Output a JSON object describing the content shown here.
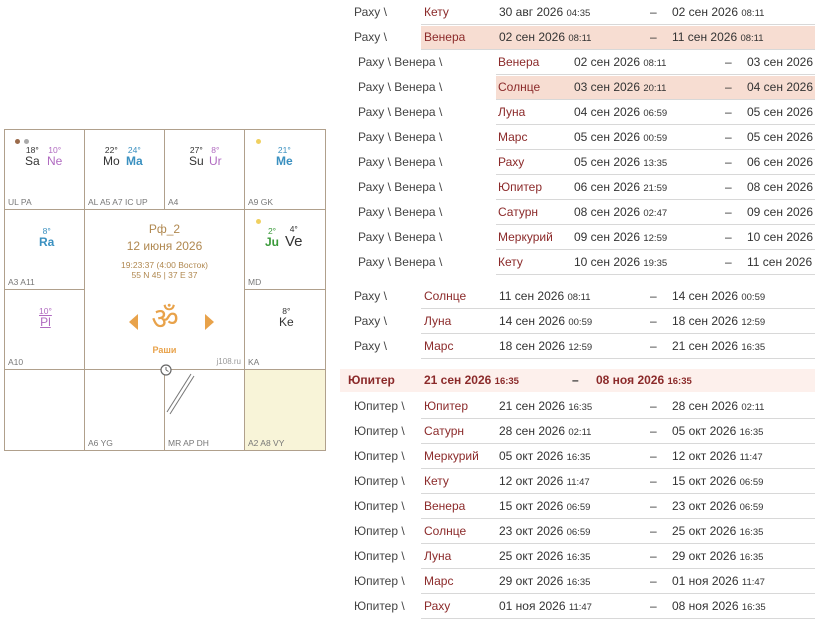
{
  "chart": {
    "name": "Рф_2",
    "date": "12 июня 2026",
    "time": "19:23:37 (4:00 Восток)",
    "coords": "55 N 45 | 37 E 37",
    "varga": "Раши",
    "site": "j108.ru",
    "om": "ॐ",
    "houses": [
      {
        "label": "UL PA"
      },
      {
        "label": "AL A5 A7 IC UP"
      },
      {
        "label": "A4"
      },
      {
        "label": "A9 GK"
      },
      {
        "label": "A3 A11"
      },
      {
        "label": "MD"
      },
      {
        "label": "A10"
      },
      {
        "label": "KA"
      },
      {
        "label": ""
      },
      {
        "label": "A6 YG"
      },
      {
        "label": "MR AP DH"
      },
      {
        "label": "A2 A8 VY"
      }
    ],
    "planets": {
      "sa": {
        "deg": "18°",
        "name": "Sa"
      },
      "ne": {
        "deg": "10°",
        "name": "Ne"
      },
      "mo": {
        "deg": "22°",
        "name": "Mo"
      },
      "ma": {
        "deg": "24°",
        "name": "Ma"
      },
      "su": {
        "deg": "27°",
        "name": "Su"
      },
      "ur": {
        "deg": "8°",
        "name": "Ur"
      },
      "me": {
        "deg": "21°",
        "name": "Me"
      },
      "ra": {
        "deg": "8°",
        "name": "Ra"
      },
      "ju": {
        "deg": "2°",
        "name": "Ju"
      },
      "ve": {
        "deg": "4°",
        "name": "Ve"
      },
      "pl": {
        "deg": "10°",
        "name": "Pl"
      },
      "ke": {
        "deg": "8°",
        "name": "Ke"
      }
    },
    "colors": {
      "border": "#b0a08c",
      "accent": "#e8a24a",
      "highlight_house": "#f8f4d8"
    }
  },
  "rows": [
    {
      "l1": "Раху \\",
      "l2": "Кету",
      "d1": "30 авг 2026",
      "t1": "04:35",
      "d2": "02 сен 2026",
      "t2": "08:11",
      "lvl": 1
    },
    {
      "l1": "Раху \\",
      "l2": "Венера",
      "d1": "02 сен 2026",
      "t1": "08:11",
      "d2": "11 сен 2026",
      "t2": "08:11",
      "lvl": 1,
      "hl": true
    },
    {
      "l1": "Раху \\ Венера \\",
      "l2": "Венера",
      "d1": "02 сен 2026",
      "t1": "08:11",
      "d2": "03 сен 2026",
      "t2": "",
      "lvl": 2
    },
    {
      "l1": "Раху \\ Венера \\",
      "l2": "Солнце",
      "d1": "03 сен 2026",
      "t1": "20:11",
      "d2": "04 сен 2026",
      "t2": "",
      "lvl": 2,
      "hl": true
    },
    {
      "l1": "Раху \\ Венера \\",
      "l2": "Луна",
      "d1": "04 сен 2026",
      "t1": "06:59",
      "d2": "05 сен 2026",
      "t2": "",
      "lvl": 2
    },
    {
      "l1": "Раху \\ Венера \\",
      "l2": "Марс",
      "d1": "05 сен 2026",
      "t1": "00:59",
      "d2": "05 сен 2026",
      "t2": "",
      "lvl": 2
    },
    {
      "l1": "Раху \\ Венера \\",
      "l2": "Раху",
      "d1": "05 сен 2026",
      "t1": "13:35",
      "d2": "06 сен 2026",
      "t2": "",
      "lvl": 2
    },
    {
      "l1": "Раху \\ Венера \\",
      "l2": "Юпитер",
      "d1": "06 сен 2026",
      "t1": "21:59",
      "d2": "08 сен 2026",
      "t2": "",
      "lvl": 2
    },
    {
      "l1": "Раху \\ Венера \\",
      "l2": "Сатурн",
      "d1": "08 сен 2026",
      "t1": "02:47",
      "d2": "09 сен 2026",
      "t2": "",
      "lvl": 2
    },
    {
      "l1": "Раху \\ Венера \\",
      "l2": "Меркурий",
      "d1": "09 сен 2026",
      "t1": "12:59",
      "d2": "10 сен 2026",
      "t2": "",
      "lvl": 2
    },
    {
      "l1": "Раху \\ Венера \\",
      "l2": "Кету",
      "d1": "10 сен 2026",
      "t1": "19:35",
      "d2": "11 сен 2026",
      "t2": "",
      "lvl": 2
    },
    {
      "l1": "Раху \\",
      "l2": "Солнце",
      "d1": "11 сен 2026",
      "t1": "08:11",
      "d2": "14 сен 2026",
      "t2": "00:59",
      "lvl": 1
    },
    {
      "l1": "Раху \\",
      "l2": "Луна",
      "d1": "14 сен 2026",
      "t1": "00:59",
      "d2": "18 сен 2026",
      "t2": "12:59",
      "lvl": 1
    },
    {
      "l1": "Раху \\",
      "l2": "Марс",
      "d1": "18 сен 2026",
      "t1": "12:59",
      "d2": "21 сен 2026",
      "t2": "16:35",
      "lvl": 1
    },
    {
      "l1": "Юпитер",
      "l2": "",
      "d1": "21 сен 2026",
      "t1": "16:35",
      "d2": "08 ноя 2026",
      "t2": "16:35",
      "lvl": 0
    },
    {
      "l1": "Юпитер \\",
      "l2": "Юпитер",
      "d1": "21 сен 2026",
      "t1": "16:35",
      "d2": "28 сен 2026",
      "t2": "02:11",
      "lvl": 1
    },
    {
      "l1": "Юпитер \\",
      "l2": "Сатурн",
      "d1": "28 сен 2026",
      "t1": "02:11",
      "d2": "05 окт 2026",
      "t2": "16:35",
      "lvl": 1
    },
    {
      "l1": "Юпитер \\",
      "l2": "Меркурий",
      "d1": "05 окт 2026",
      "t1": "16:35",
      "d2": "12 окт 2026",
      "t2": "11:47",
      "lvl": 1
    },
    {
      "l1": "Юпитер \\",
      "l2": "Кету",
      "d1": "12 окт 2026",
      "t1": "11:47",
      "d2": "15 окт 2026",
      "t2": "06:59",
      "lvl": 1
    },
    {
      "l1": "Юпитер \\",
      "l2": "Венера",
      "d1": "15 окт 2026",
      "t1": "06:59",
      "d2": "23 окт 2026",
      "t2": "06:59",
      "lvl": 1
    },
    {
      "l1": "Юпитер \\",
      "l2": "Солнце",
      "d1": "23 окт 2026",
      "t1": "06:59",
      "d2": "25 окт 2026",
      "t2": "16:35",
      "lvl": 1
    },
    {
      "l1": "Юпитер \\",
      "l2": "Луна",
      "d1": "25 окт 2026",
      "t1": "16:35",
      "d2": "29 окт 2026",
      "t2": "16:35",
      "lvl": 1
    },
    {
      "l1": "Юпитер \\",
      "l2": "Марс",
      "d1": "29 окт 2026",
      "t1": "16:35",
      "d2": "01 ноя 2026",
      "t2": "11:47",
      "lvl": 1
    },
    {
      "l1": "Юпитер \\",
      "l2": "Раху",
      "d1": "01 ноя 2026",
      "t1": "11:47",
      "d2": "08 ноя 2026",
      "t2": "16:35",
      "lvl": 1
    }
  ],
  "dash": "–"
}
